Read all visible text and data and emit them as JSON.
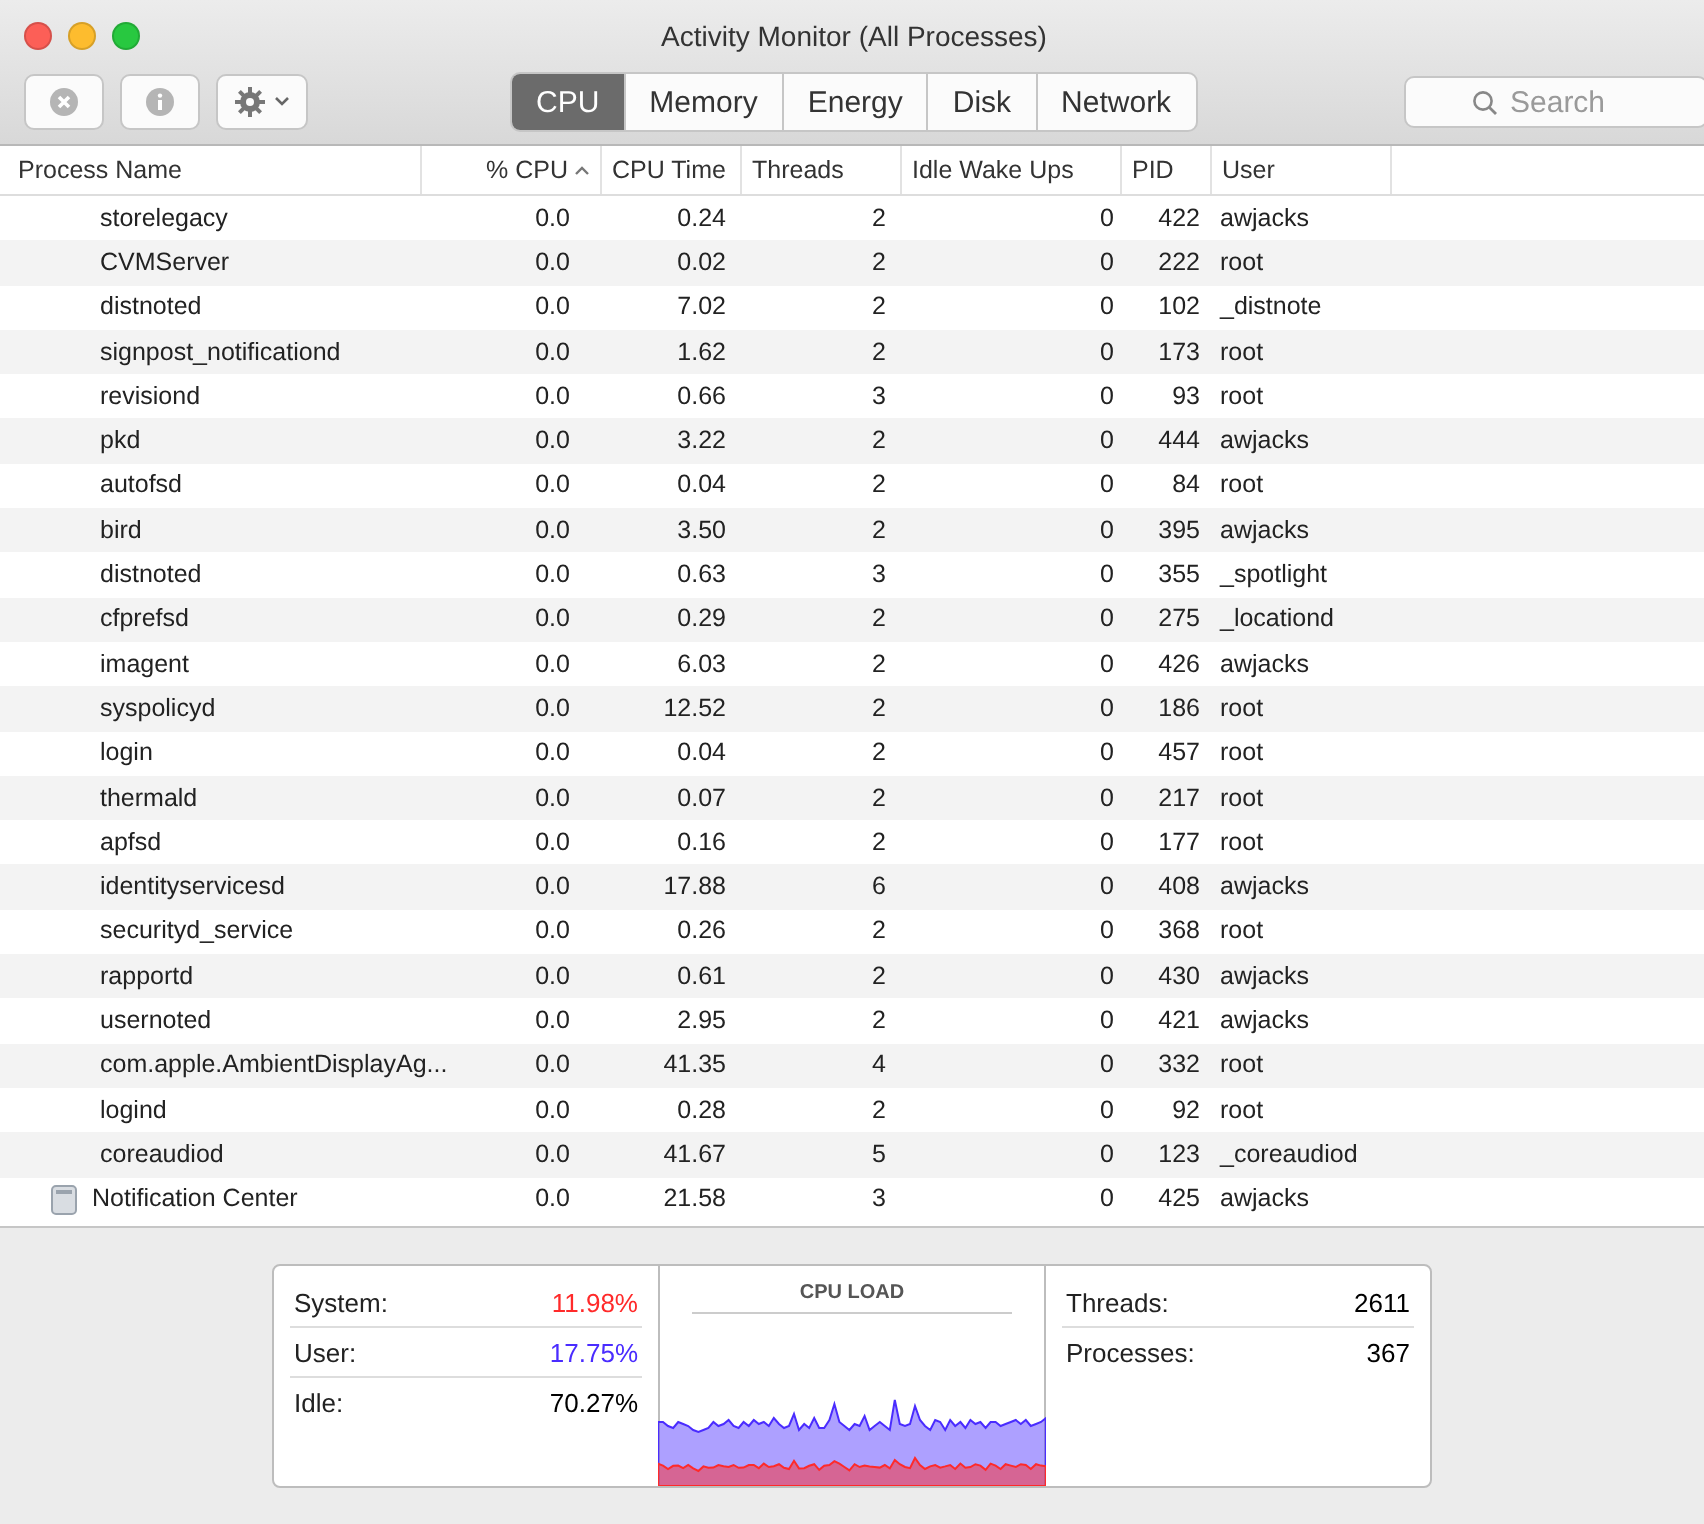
{
  "window": {
    "title": "Activity Monitor (All Processes)"
  },
  "tabs": [
    {
      "label": "CPU",
      "selected": true
    },
    {
      "label": "Memory",
      "selected": false
    },
    {
      "label": "Energy",
      "selected": false
    },
    {
      "label": "Disk",
      "selected": false
    },
    {
      "label": "Network",
      "selected": false
    }
  ],
  "search": {
    "placeholder": "Search"
  },
  "table": {
    "columns": [
      {
        "label": "Process Name",
        "sorted": false
      },
      {
        "label": "% CPU",
        "sorted": true
      },
      {
        "label": "CPU Time",
        "sorted": false
      },
      {
        "label": "Threads",
        "sorted": false
      },
      {
        "label": "Idle Wake Ups",
        "sorted": false
      },
      {
        "label": "PID",
        "sorted": false
      },
      {
        "label": "User",
        "sorted": false
      }
    ],
    "rows": [
      {
        "cells": [
          "storelegacy",
          "0.0",
          "0.24",
          "2",
          "0",
          "422",
          "awjacks"
        ],
        "has_icon": false
      },
      {
        "cells": [
          "CVMServer",
          "0.0",
          "0.02",
          "2",
          "0",
          "222",
          "root"
        ],
        "has_icon": false
      },
      {
        "cells": [
          "distnoted",
          "0.0",
          "7.02",
          "2",
          "0",
          "102",
          "_distnote"
        ],
        "has_icon": false
      },
      {
        "cells": [
          "signpost_notificationd",
          "0.0",
          "1.62",
          "2",
          "0",
          "173",
          "root"
        ],
        "has_icon": false
      },
      {
        "cells": [
          "revisiond",
          "0.0",
          "0.66",
          "3",
          "0",
          "93",
          "root"
        ],
        "has_icon": false
      },
      {
        "cells": [
          "pkd",
          "0.0",
          "3.22",
          "2",
          "0",
          "444",
          "awjacks"
        ],
        "has_icon": false
      },
      {
        "cells": [
          "autofsd",
          "0.0",
          "0.04",
          "2",
          "0",
          "84",
          "root"
        ],
        "has_icon": false
      },
      {
        "cells": [
          "bird",
          "0.0",
          "3.50",
          "2",
          "0",
          "395",
          "awjacks"
        ],
        "has_icon": false
      },
      {
        "cells": [
          "distnoted",
          "0.0",
          "0.63",
          "3",
          "0",
          "355",
          "_spotlight"
        ],
        "has_icon": false
      },
      {
        "cells": [
          "cfprefsd",
          "0.0",
          "0.29",
          "2",
          "0",
          "275",
          "_locationd"
        ],
        "has_icon": false
      },
      {
        "cells": [
          "imagent",
          "0.0",
          "6.03",
          "2",
          "0",
          "426",
          "awjacks"
        ],
        "has_icon": false
      },
      {
        "cells": [
          "syspolicyd",
          "0.0",
          "12.52",
          "2",
          "0",
          "186",
          "root"
        ],
        "has_icon": false
      },
      {
        "cells": [
          "login",
          "0.0",
          "0.04",
          "2",
          "0",
          "457",
          "root"
        ],
        "has_icon": false
      },
      {
        "cells": [
          "thermald",
          "0.0",
          "0.07",
          "2",
          "0",
          "217",
          "root"
        ],
        "has_icon": false
      },
      {
        "cells": [
          "apfsd",
          "0.0",
          "0.16",
          "2",
          "0",
          "177",
          "root"
        ],
        "has_icon": false
      },
      {
        "cells": [
          "identityservicesd",
          "0.0",
          "17.88",
          "6",
          "0",
          "408",
          "awjacks"
        ],
        "has_icon": false
      },
      {
        "cells": [
          "securityd_service",
          "0.0",
          "0.26",
          "2",
          "0",
          "368",
          "root"
        ],
        "has_icon": false
      },
      {
        "cells": [
          "rapportd",
          "0.0",
          "0.61",
          "2",
          "0",
          "430",
          "awjacks"
        ],
        "has_icon": false
      },
      {
        "cells": [
          "usernoted",
          "0.0",
          "2.95",
          "2",
          "0",
          "421",
          "awjacks"
        ],
        "has_icon": false
      },
      {
        "cells": [
          "com.apple.AmbientDisplayAg...",
          "0.0",
          "41.35",
          "4",
          "0",
          "332",
          "root"
        ],
        "has_icon": false
      },
      {
        "cells": [
          "logind",
          "0.0",
          "0.28",
          "2",
          "0",
          "92",
          "root"
        ],
        "has_icon": false
      },
      {
        "cells": [
          "coreaudiod",
          "0.0",
          "41.67",
          "5",
          "0",
          "123",
          "_coreaudiod"
        ],
        "has_icon": false
      },
      {
        "cells": [
          "Notification Center",
          "0.0",
          "21.58",
          "3",
          "0",
          "425",
          "awjacks"
        ],
        "has_icon": true
      }
    ]
  },
  "summary": {
    "stats": [
      {
        "label": "System:",
        "value": "11.98%",
        "color": "#ff2a2a"
      },
      {
        "label": "User:",
        "value": "17.75%",
        "color": "#4a2cff"
      },
      {
        "label": "Idle:",
        "value": "70.27%",
        "color": "#000000"
      }
    ],
    "chart_title": "CPU LOAD",
    "counts": [
      {
        "label": "Threads:",
        "value": "2611"
      },
      {
        "label": "Processes:",
        "value": "367"
      }
    ]
  }
}
